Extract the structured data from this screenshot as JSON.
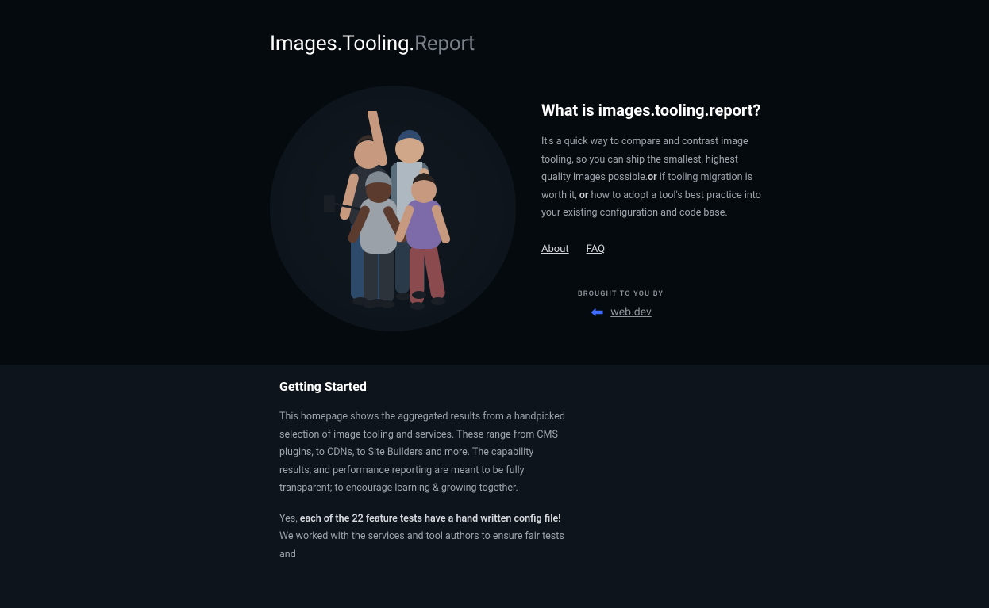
{
  "brand": {
    "part1": "Images.",
    "part2": "Tooling.",
    "part3": "Report"
  },
  "hero": {
    "title": "What is images.tooling.report?",
    "para_pre": "It's a quick way to compare and contrast image tooling, so you can ship the smallest, highest quality images possible.",
    "para_bold1": "or",
    "para_mid": " if tooling migration is worth it, ",
    "para_bold2": "or",
    "para_post": " how to adopt a tool's best practice into your existing configuration and code base.",
    "link_about": "About",
    "link_faq": "FAQ"
  },
  "brought": {
    "label": "BROUGHT TO YOU BY",
    "site": "web.dev"
  },
  "getting_started": {
    "title": "Getting Started",
    "p1": "This homepage shows the aggregated results from a handpicked selection of image tooling and services. These range from CMS plugins, to CDNs, to Site Builders and more. The capability results, and performance reporting are meant to be fully transparent; to encourage learning & growing together.",
    "p2_pre": "Yes, ",
    "p2_bold": "each of the 22 feature tests have a hand written config file!",
    "p2_post": " We worked with the services and tool authors to ensure fair tests and"
  }
}
